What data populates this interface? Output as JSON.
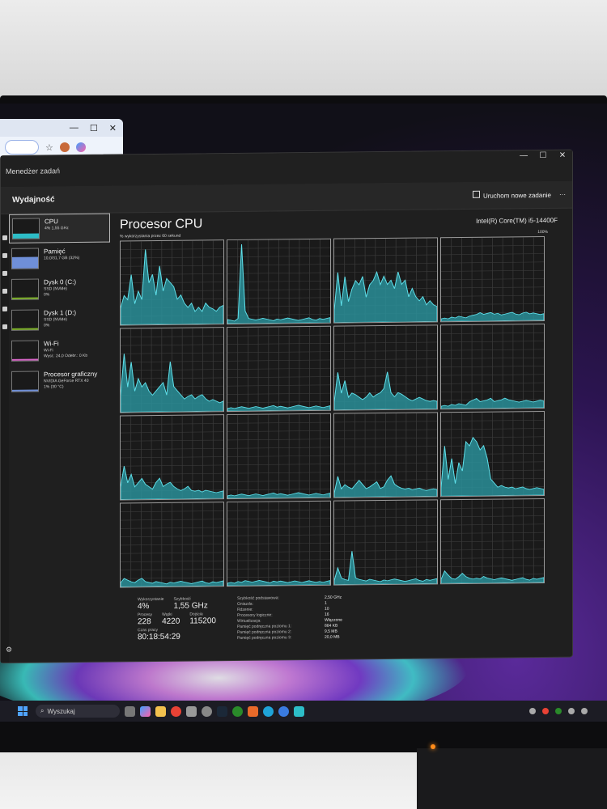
{
  "browser": {
    "window_controls": [
      "—",
      "☐",
      "✕"
    ],
    "star": "☆"
  },
  "taskmanager": {
    "app_title": "Menedżer zadań",
    "section": "Wydajność",
    "new_task": "Uruchom nowe zadanie",
    "more": "···",
    "window_controls": [
      "—",
      "☐",
      "✕"
    ],
    "devices": [
      {
        "name": "CPU",
        "sub": "4% 1,55 GHz",
        "color": "#2dbdc7"
      },
      {
        "name": "Pamięć",
        "sub": "10,0/31,7 GB (32%)",
        "color": "#6f8fd8"
      },
      {
        "name": "Dysk 0 (C:)",
        "sub": "SSD (NVMe)",
        "sub2": "0%",
        "color": "#7fb32a"
      },
      {
        "name": "Dysk 1 (D:)",
        "sub": "SSD (NVMe)",
        "sub2": "0%",
        "color": "#7fb32a"
      },
      {
        "name": "Wi-Fi",
        "sub": "Wi-Fi",
        "sub2": "Wysł.: 24,0 Odebr.: 0 Kb",
        "color": "#d665c6"
      },
      {
        "name": "Procesor graficzny",
        "sub": "NVIDIA GeForce RTX 40",
        "sub2": "1% (30 °C)",
        "color": "#6f8fd8"
      }
    ],
    "cpu": {
      "title": "Procesor CPU",
      "model": "Intel(R) Core(TM) i5-14400F",
      "caption": "% wykorzystania przez 60 sekund",
      "max_label": "100%",
      "stats": {
        "utilization_label": "Wykorzystanie",
        "utilization": "4%",
        "speed_label": "Szybkość",
        "speed": "1,55 GHz",
        "processes_label": "Procesy",
        "processes": "228",
        "threads_label": "Wątki",
        "threads": "4220",
        "handles_label": "Dojścia",
        "handles": "115200",
        "uptime_label": "Czas pracy",
        "uptime": "80:18:54:29"
      },
      "specs": [
        {
          "k": "Szybkość podstawowa:",
          "v": "2,50 GHz"
        },
        {
          "k": "Gniazda:",
          "v": "1"
        },
        {
          "k": "Rdzenie:",
          "v": "10"
        },
        {
          "k": "Procesory logiczne:",
          "v": "16"
        },
        {
          "k": "Wirtualizacja:",
          "v": "Włączone"
        },
        {
          "k": "Pamięć podręczna poziomu 1:",
          "v": "864 KB"
        },
        {
          "k": "Pamięć podręczna poziomu 2:",
          "v": "9,5 MB"
        },
        {
          "k": "Pamięć podręczna poziomu 3:",
          "v": "20,0 MB"
        }
      ],
      "cores": [
        [
          20,
          35,
          30,
          60,
          25,
          40,
          30,
          90,
          50,
          60,
          35,
          70,
          40,
          55,
          50,
          45,
          30,
          35,
          25,
          20,
          25,
          15,
          20,
          15,
          25,
          20,
          18,
          15,
          20,
          22
        ],
        [
          5,
          4,
          3,
          6,
          95,
          15,
          6,
          5,
          4,
          5,
          6,
          5,
          4,
          3,
          5,
          4,
          5,
          6,
          5,
          4,
          3,
          4,
          5,
          6,
          4,
          3,
          5,
          4,
          5,
          6
        ],
        [
          15,
          60,
          20,
          55,
          25,
          40,
          50,
          45,
          55,
          30,
          45,
          50,
          60,
          45,
          55,
          45,
          50,
          40,
          60,
          45,
          50,
          30,
          40,
          30,
          25,
          30,
          20,
          25,
          20,
          18
        ],
        [
          3,
          4,
          3,
          5,
          4,
          6,
          5,
          4,
          6,
          7,
          8,
          10,
          8,
          9,
          10,
          8,
          9,
          7,
          8,
          9,
          10,
          8,
          7,
          9,
          10,
          8,
          9,
          8,
          7,
          8
        ],
        [
          20,
          70,
          30,
          60,
          25,
          40,
          30,
          35,
          25,
          20,
          25,
          30,
          35,
          20,
          60,
          30,
          25,
          20,
          15,
          18,
          20,
          15,
          18,
          20,
          15,
          12,
          14,
          12,
          10,
          12
        ],
        [
          3,
          4,
          3,
          4,
          5,
          4,
          3,
          4,
          5,
          4,
          3,
          4,
          5,
          6,
          4,
          5,
          4,
          3,
          4,
          5,
          6,
          5,
          4,
          3,
          4,
          5,
          4,
          3,
          4,
          5
        ],
        [
          10,
          45,
          20,
          35,
          15,
          20,
          18,
          15,
          12,
          15,
          20,
          15,
          18,
          20,
          25,
          45,
          20,
          15,
          20,
          18,
          15,
          12,
          10,
          12,
          14,
          12,
          10,
          9,
          10,
          9
        ],
        [
          3,
          4,
          3,
          5,
          4,
          6,
          5,
          4,
          8,
          10,
          12,
          8,
          9,
          10,
          12,
          8,
          9,
          10,
          12,
          10,
          9,
          8,
          7,
          8,
          9,
          8,
          7,
          8,
          9,
          8
        ],
        [
          15,
          40,
          20,
          30,
          15,
          20,
          25,
          18,
          15,
          12,
          20,
          25,
          15,
          18,
          20,
          15,
          12,
          10,
          12,
          15,
          10,
          9,
          10,
          8,
          10,
          9,
          8,
          7,
          8,
          9
        ],
        [
          3,
          4,
          3,
          4,
          5,
          4,
          3,
          4,
          5,
          4,
          3,
          4,
          5,
          6,
          4,
          5,
          4,
          3,
          4,
          5,
          6,
          5,
          4,
          3,
          4,
          5,
          4,
          3,
          4,
          5
        ],
        [
          5,
          25,
          10,
          15,
          12,
          10,
          15,
          20,
          15,
          10,
          12,
          15,
          18,
          10,
          12,
          20,
          25,
          15,
          12,
          10,
          9,
          10,
          8,
          9,
          10,
          8,
          7,
          8,
          9,
          8
        ],
        [
          10,
          60,
          20,
          45,
          15,
          40,
          30,
          65,
          60,
          70,
          65,
          55,
          60,
          45,
          20,
          15,
          10,
          12,
          10,
          9,
          10,
          8,
          9,
          10,
          8,
          7,
          8,
          9,
          8,
          7
        ],
        [
          5,
          10,
          8,
          6,
          5,
          8,
          10,
          6,
          5,
          4,
          6,
          5,
          4,
          3,
          5,
          4,
          5,
          6,
          5,
          4,
          3,
          4,
          5,
          6,
          4,
          3,
          5,
          4,
          5,
          6
        ],
        [
          3,
          4,
          3,
          5,
          4,
          6,
          5,
          4,
          5,
          6,
          5,
          4,
          3,
          5,
          4,
          5,
          4,
          3,
          4,
          5,
          4,
          3,
          4,
          5,
          4,
          3,
          4,
          3,
          4,
          5
        ],
        [
          5,
          20,
          8,
          6,
          5,
          40,
          8,
          6,
          5,
          4,
          6,
          5,
          4,
          3,
          5,
          4,
          5,
          6,
          5,
          4,
          3,
          4,
          5,
          6,
          4,
          3,
          5,
          4,
          5,
          6
        ],
        [
          5,
          15,
          10,
          6,
          5,
          8,
          12,
          8,
          6,
          5,
          6,
          5,
          8,
          6,
          5,
          4,
          5,
          6,
          5,
          4,
          3,
          4,
          5,
          6,
          4,
          3,
          5,
          4,
          5,
          6
        ]
      ]
    }
  },
  "taskbar": {
    "search": "Wyszukaj"
  }
}
